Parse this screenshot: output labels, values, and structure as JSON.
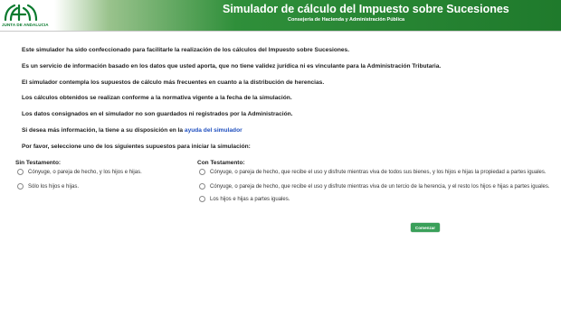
{
  "header": {
    "logo_text": "JUNTA DE ANDALUCIA",
    "title": "Simulador de cálculo del Impuesto sobre Sucesiones",
    "subtitle": "Consejería de Hacienda y Administración Pública"
  },
  "intro": {
    "p1": "Este simulador ha sido confeccionado para facilitarle la realización de los cálculos del Impuesto sobre Sucesiones.",
    "p2": "Es un servicio de información basado en los datos que usted aporta, que no tiene validez jurídica ni es vinculante para la Administración Tributaria.",
    "p3": "El simulador contempla los supuestos de cálculo más frecuentes en cuanto a la distribución de herencias.",
    "p4": "Los cálculos obtenidos se realizan conforme a la normativa vigente a la fecha de la simulación.",
    "p5": "Los datos consignados en el simulador no son guardados ni registrados por la Administración.",
    "p6_prefix": "Si desea más información, la tiene a su disposición en la ",
    "p6_link": "ayuda del simulador",
    "p7": "Por favor, seleccione uno de los siguientes supuestos para iniciar la simulación:"
  },
  "sin_testamento": {
    "title": "Sin Testamento:",
    "options": [
      "Cónyuge, o pareja de hecho, y los hijos e hijas.",
      "Sólo los hijos e hijas."
    ]
  },
  "con_testamento": {
    "title": "Con Testamento:",
    "options": [
      "Cónyuge, o pareja de hecho, que recibe el uso y disfrute mientras viva de todos sus bienes, y los hijos e hijas la propiedad a partes iguales.",
      "Cónyuge, o pareja de hecho, que recibe el uso y disfrute mientras viva de un tercio de la herencia, y el resto los hijos e hijas a partes iguales.",
      "Los hijos e hijas a partes iguales."
    ]
  },
  "actions": {
    "start_label": "Comenzar"
  },
  "colors": {
    "header_green": "#1f7a2c",
    "button_green": "#3aa05a",
    "link_blue": "#1f4fbf"
  }
}
